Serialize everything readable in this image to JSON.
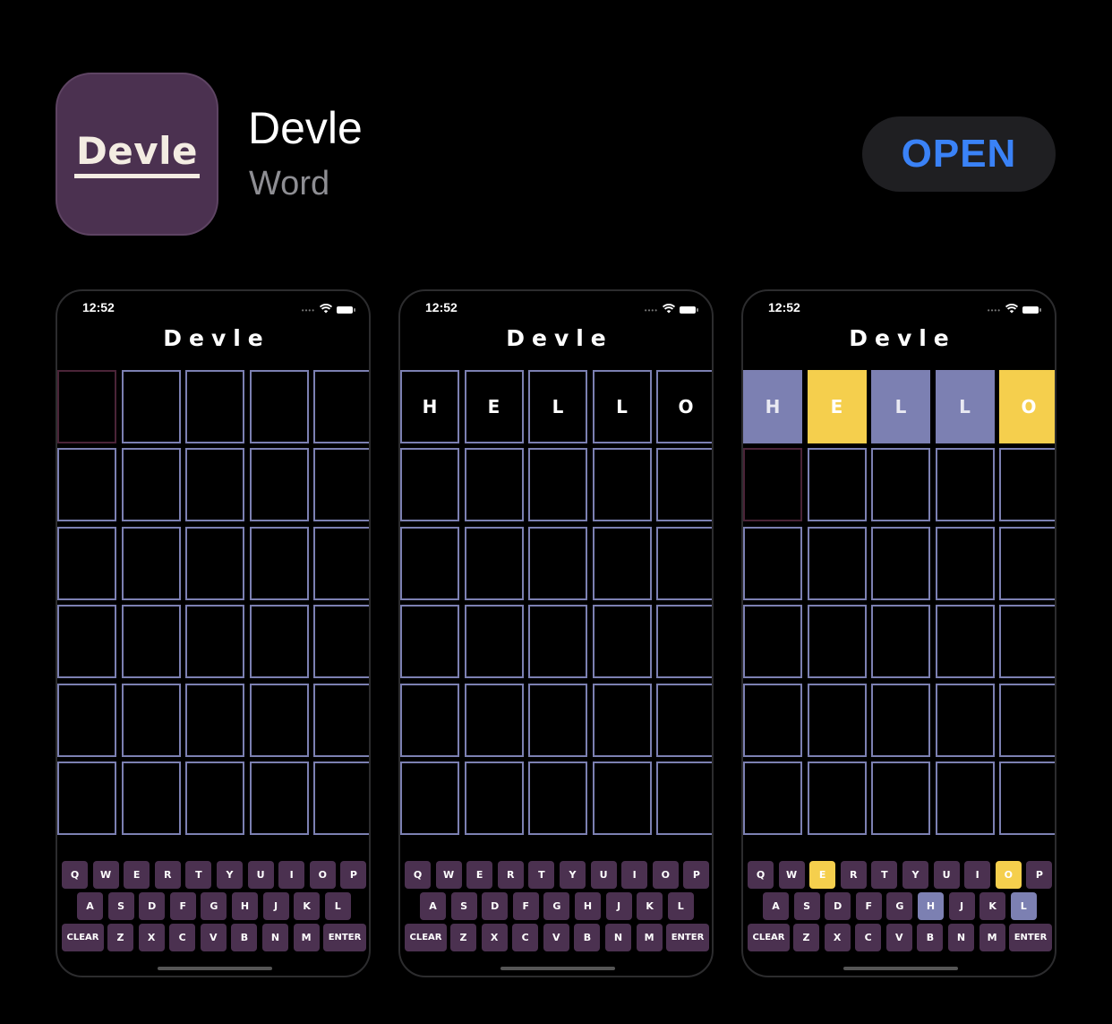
{
  "app": {
    "icon_text": "Devle",
    "name": "Devle",
    "category": "Word",
    "open_label": "OPEN"
  },
  "colors": {
    "background": "#000000",
    "icon_bg": "#4b3150",
    "open_bg": "#1f1f22",
    "open_text": "#3a82f7",
    "tile_border": "#7c80b2",
    "tile_absent": "#7c80b2",
    "tile_present": "#f5cf4d",
    "key_bg": "#4b3150",
    "active_tile_border": "#4b2438"
  },
  "icons": [
    "wifi-icon",
    "battery-icon",
    "cellular-signal-icon"
  ],
  "screenshots": [
    {
      "time": "12:52",
      "title": "Devle",
      "board": [
        [
          {
            "l": "",
            "s": "active"
          },
          {
            "l": "",
            "s": "empty"
          },
          {
            "l": "",
            "s": "empty"
          },
          {
            "l": "",
            "s": "empty"
          },
          {
            "l": "",
            "s": "empty"
          }
        ],
        [
          {
            "l": "",
            "s": "empty"
          },
          {
            "l": "",
            "s": "empty"
          },
          {
            "l": "",
            "s": "empty"
          },
          {
            "l": "",
            "s": "empty"
          },
          {
            "l": "",
            "s": "empty"
          }
        ],
        [
          {
            "l": "",
            "s": "empty"
          },
          {
            "l": "",
            "s": "empty"
          },
          {
            "l": "",
            "s": "empty"
          },
          {
            "l": "",
            "s": "empty"
          },
          {
            "l": "",
            "s": "empty"
          }
        ],
        [
          {
            "l": "",
            "s": "empty"
          },
          {
            "l": "",
            "s": "empty"
          },
          {
            "l": "",
            "s": "empty"
          },
          {
            "l": "",
            "s": "empty"
          },
          {
            "l": "",
            "s": "empty"
          }
        ],
        [
          {
            "l": "",
            "s": "empty"
          },
          {
            "l": "",
            "s": "empty"
          },
          {
            "l": "",
            "s": "empty"
          },
          {
            "l": "",
            "s": "empty"
          },
          {
            "l": "",
            "s": "empty"
          }
        ],
        [
          {
            "l": "",
            "s": "empty"
          },
          {
            "l": "",
            "s": "empty"
          },
          {
            "l": "",
            "s": "empty"
          },
          {
            "l": "",
            "s": "empty"
          },
          {
            "l": "",
            "s": "empty"
          }
        ]
      ],
      "key_states": {}
    },
    {
      "time": "12:52",
      "title": "Devle",
      "board": [
        [
          {
            "l": "H",
            "s": "empty"
          },
          {
            "l": "E",
            "s": "empty"
          },
          {
            "l": "L",
            "s": "empty"
          },
          {
            "l": "L",
            "s": "empty"
          },
          {
            "l": "O",
            "s": "empty"
          }
        ],
        [
          {
            "l": "",
            "s": "empty"
          },
          {
            "l": "",
            "s": "empty"
          },
          {
            "l": "",
            "s": "empty"
          },
          {
            "l": "",
            "s": "empty"
          },
          {
            "l": "",
            "s": "empty"
          }
        ],
        [
          {
            "l": "",
            "s": "empty"
          },
          {
            "l": "",
            "s": "empty"
          },
          {
            "l": "",
            "s": "empty"
          },
          {
            "l": "",
            "s": "empty"
          },
          {
            "l": "",
            "s": "empty"
          }
        ],
        [
          {
            "l": "",
            "s": "empty"
          },
          {
            "l": "",
            "s": "empty"
          },
          {
            "l": "",
            "s": "empty"
          },
          {
            "l": "",
            "s": "empty"
          },
          {
            "l": "",
            "s": "empty"
          }
        ],
        [
          {
            "l": "",
            "s": "empty"
          },
          {
            "l": "",
            "s": "empty"
          },
          {
            "l": "",
            "s": "empty"
          },
          {
            "l": "",
            "s": "empty"
          },
          {
            "l": "",
            "s": "empty"
          }
        ],
        [
          {
            "l": "",
            "s": "empty"
          },
          {
            "l": "",
            "s": "empty"
          },
          {
            "l": "",
            "s": "empty"
          },
          {
            "l": "",
            "s": "empty"
          },
          {
            "l": "",
            "s": "empty"
          }
        ]
      ],
      "key_states": {}
    },
    {
      "time": "12:52",
      "title": "Devle",
      "board": [
        [
          {
            "l": "H",
            "s": "gray"
          },
          {
            "l": "E",
            "s": "yellow"
          },
          {
            "l": "L",
            "s": "gray"
          },
          {
            "l": "L",
            "s": "gray"
          },
          {
            "l": "O",
            "s": "yellow"
          }
        ],
        [
          {
            "l": "",
            "s": "active"
          },
          {
            "l": "",
            "s": "empty"
          },
          {
            "l": "",
            "s": "empty"
          },
          {
            "l": "",
            "s": "empty"
          },
          {
            "l": "",
            "s": "empty"
          }
        ],
        [
          {
            "l": "",
            "s": "empty"
          },
          {
            "l": "",
            "s": "empty"
          },
          {
            "l": "",
            "s": "empty"
          },
          {
            "l": "",
            "s": "empty"
          },
          {
            "l": "",
            "s": "empty"
          }
        ],
        [
          {
            "l": "",
            "s": "empty"
          },
          {
            "l": "",
            "s": "empty"
          },
          {
            "l": "",
            "s": "empty"
          },
          {
            "l": "",
            "s": "empty"
          },
          {
            "l": "",
            "s": "empty"
          }
        ],
        [
          {
            "l": "",
            "s": "empty"
          },
          {
            "l": "",
            "s": "empty"
          },
          {
            "l": "",
            "s": "empty"
          },
          {
            "l": "",
            "s": "empty"
          },
          {
            "l": "",
            "s": "empty"
          }
        ],
        [
          {
            "l": "",
            "s": "empty"
          },
          {
            "l": "",
            "s": "empty"
          },
          {
            "l": "",
            "s": "empty"
          },
          {
            "l": "",
            "s": "empty"
          },
          {
            "l": "",
            "s": "empty"
          }
        ]
      ],
      "key_states": {
        "E": "yellow",
        "O": "yellow",
        "H": "gray",
        "L": "gray"
      }
    }
  ],
  "keyboard": {
    "row1": [
      "Q",
      "W",
      "E",
      "R",
      "T",
      "Y",
      "U",
      "I",
      "O",
      "P"
    ],
    "row2": [
      "A",
      "S",
      "D",
      "F",
      "G",
      "H",
      "J",
      "K",
      "L"
    ],
    "row3": [
      "CLEAR",
      "Z",
      "X",
      "C",
      "V",
      "B",
      "N",
      "M",
      "ENTER"
    ]
  }
}
